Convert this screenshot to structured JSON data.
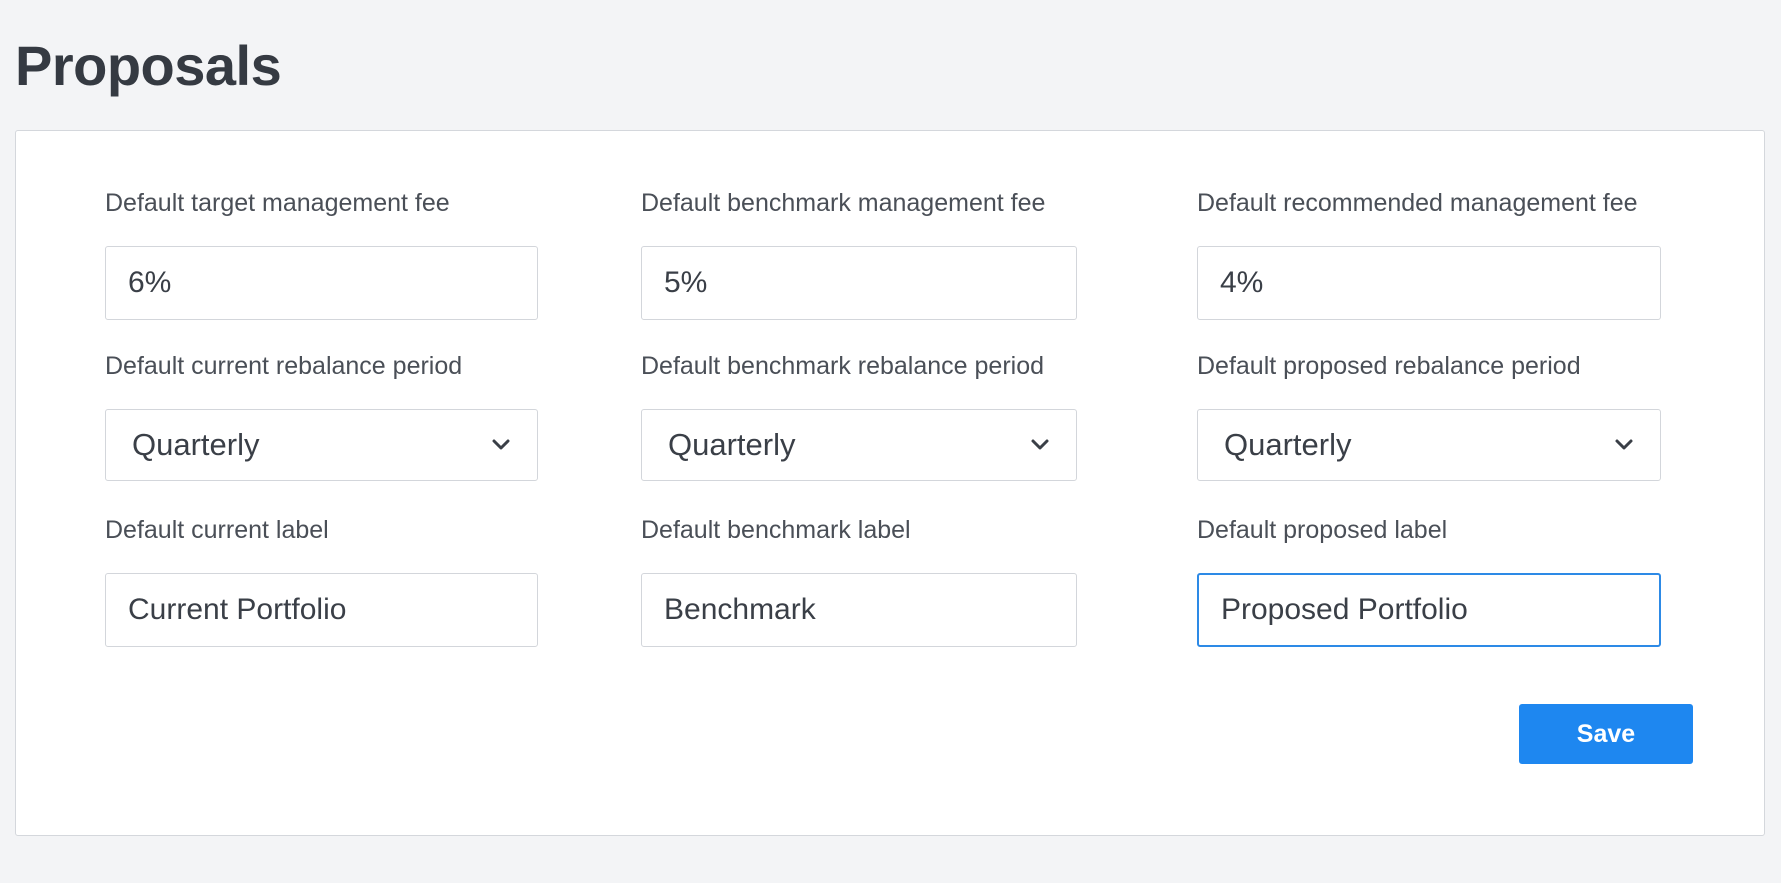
{
  "page": {
    "title": "Proposals"
  },
  "fees": {
    "target": {
      "label": "Default target management fee",
      "value": "6%"
    },
    "benchmark": {
      "label": "Default benchmark management fee",
      "value": "5%"
    },
    "recommended": {
      "label": "Default recommended management fee",
      "value": "4%"
    }
  },
  "rebalance": {
    "current": {
      "label": "Default current rebalance period",
      "value": "Quarterly"
    },
    "benchmark": {
      "label": "Default benchmark rebalance period",
      "value": "Quarterly"
    },
    "proposed": {
      "label": "Default proposed rebalance period",
      "value": "Quarterly"
    }
  },
  "labels": {
    "current": {
      "label": "Default current label",
      "value": "Current Portfolio"
    },
    "benchmark": {
      "label": "Default benchmark label",
      "value": "Benchmark"
    },
    "proposed": {
      "label": "Default proposed label",
      "value": "Proposed Portfolio"
    }
  },
  "actions": {
    "save_label": "Save"
  },
  "icons": {
    "select_arrow": "chevron-down-icon"
  },
  "colors": {
    "accent": "#1e87f0",
    "focus_border": "#2d8ae6",
    "background": "#f3f4f6",
    "card": "#ffffff"
  }
}
